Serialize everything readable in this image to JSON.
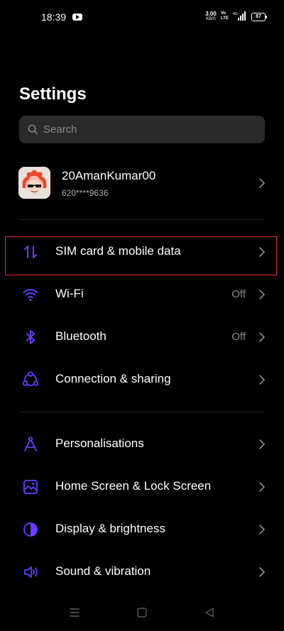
{
  "status_bar": {
    "time": "18:39",
    "net_speed_value": "3.00",
    "net_speed_unit": "KB/S",
    "volte_1": "Vo",
    "volte_2": "LTE",
    "battery": "87"
  },
  "page_title": "Settings",
  "search": {
    "placeholder": "Search"
  },
  "profile": {
    "name": "20AmanKumar00",
    "phone": "620****9636"
  },
  "group1": [
    {
      "label": "SIM card & mobile data",
      "icon": "sim-data-icon",
      "value": ""
    },
    {
      "label": "Wi-Fi",
      "icon": "wifi-icon",
      "value": "Off"
    },
    {
      "label": "Bluetooth",
      "icon": "bluetooth-icon",
      "value": "Off"
    },
    {
      "label": "Connection & sharing",
      "icon": "connection-sharing-icon",
      "value": ""
    }
  ],
  "group2": [
    {
      "label": "Personalisations",
      "icon": "personalisation-icon"
    },
    {
      "label": "Home Screen & Lock Screen",
      "icon": "home-lock-screen-icon"
    },
    {
      "label": "Display & brightness",
      "icon": "display-brightness-icon"
    },
    {
      "label": "Sound & vibration",
      "icon": "sound-vibration-icon"
    }
  ],
  "colors": {
    "accent": "#6b3bff",
    "highlight_border": "#e32b2b",
    "background": "#000000",
    "search_bg": "#2a2a2a"
  }
}
